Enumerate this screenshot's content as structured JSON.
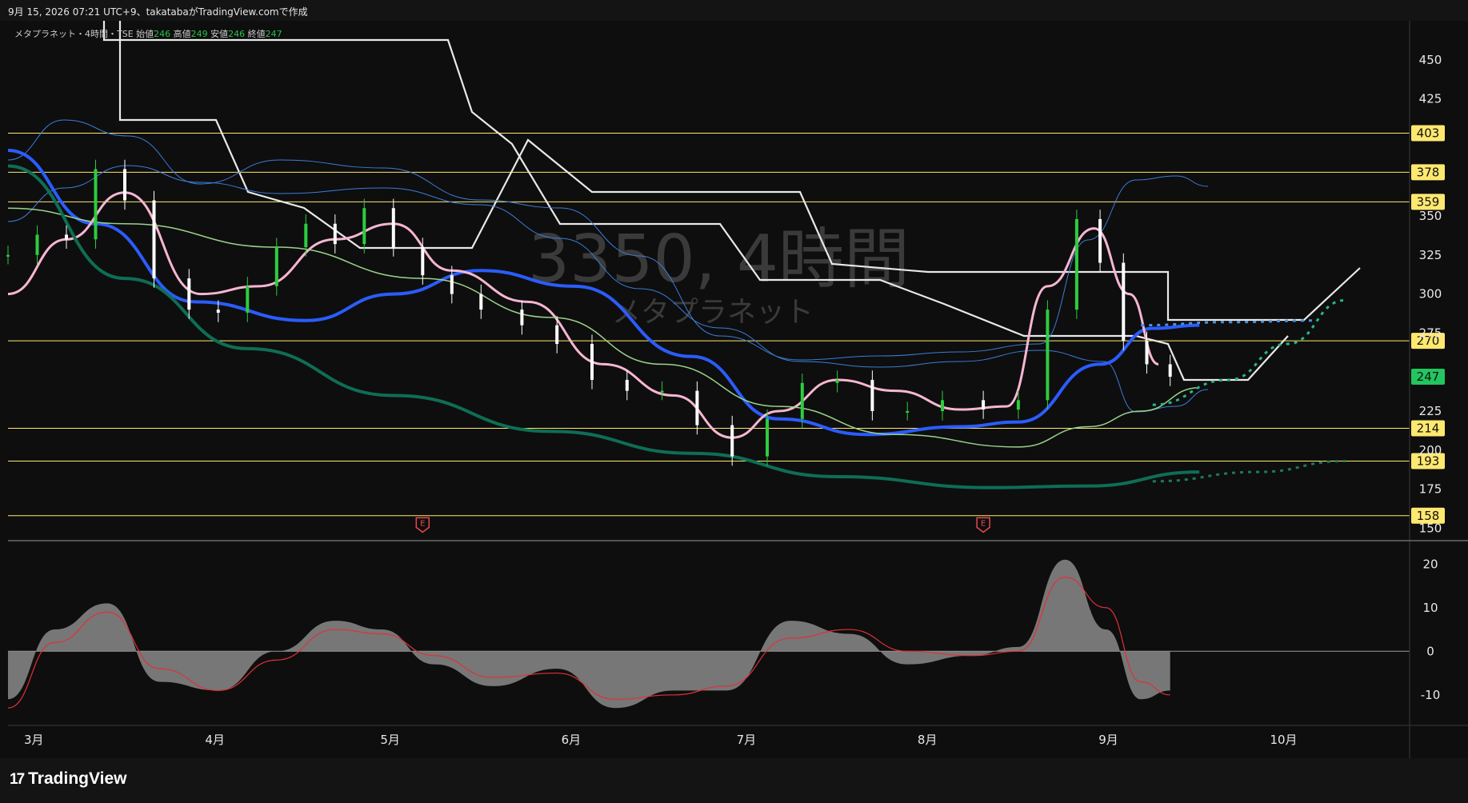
{
  "header": {
    "caption": "9月 15, 2026 07:21 UTC+9、takatabaがTradingView.comで作成"
  },
  "legend": {
    "symbol": "メタプラネット・4時間・TSE",
    "open_label": "始値",
    "open": "246",
    "high_label": "高値",
    "high": "249",
    "low_label": "安値",
    "low": "246",
    "close_label": "終値",
    "close": "247"
  },
  "watermark": {
    "ticker": "3350, 4時間",
    "name": "メタプラネット"
  },
  "brand": {
    "name": "TradingView"
  },
  "colors": {
    "bull": "#2ecc40",
    "bear": "#ffffff",
    "level_line": "#ffe870",
    "blue_ma": "#2b5cff",
    "pink_ma": "#f7b6d2",
    "green_long_ma": "#0e6e55",
    "panel_fill": "#8a8a8a"
  },
  "chart_data": {
    "type": "line",
    "price_axis": {
      "ticks": [
        450,
        425,
        350,
        325,
        300,
        275,
        225,
        200,
        175,
        150
      ],
      "range": [
        142,
        475
      ]
    },
    "horizontal_levels": [
      403,
      378,
      359,
      270,
      214,
      193,
      158
    ],
    "last_price": 247,
    "time_axis": {
      "labels": [
        "3月",
        "4月",
        "5月",
        "6月",
        "7月",
        "8月",
        "9月",
        "10月"
      ],
      "range": [
        "2026-02-28",
        "2026-10-26"
      ]
    },
    "earnings_markers": [
      "E",
      "E"
    ],
    "close_series": {
      "dates": [
        "2026-02-28",
        "2026-03-05",
        "2026-03-10",
        "2026-03-15",
        "2026-03-20",
        "2026-03-25",
        "2026-03-31",
        "2026-04-05",
        "2026-04-10",
        "2026-04-15",
        "2026-04-20",
        "2026-04-25",
        "2026-04-30",
        "2026-05-05",
        "2026-05-10",
        "2026-05-15",
        "2026-05-20",
        "2026-05-27",
        "2026-06-02",
        "2026-06-08",
        "2026-06-14",
        "2026-06-20",
        "2026-06-26",
        "2026-07-02",
        "2026-07-08",
        "2026-07-14",
        "2026-07-20",
        "2026-07-26",
        "2026-08-01",
        "2026-08-07",
        "2026-08-14",
        "2026-08-20",
        "2026-08-25",
        "2026-08-30",
        "2026-09-03",
        "2026-09-07",
        "2026-09-11",
        "2026-09-15"
      ],
      "values": [
        325,
        338,
        335,
        380,
        360,
        310,
        290,
        288,
        305,
        330,
        345,
        332,
        355,
        330,
        312,
        300,
        290,
        280,
        268,
        245,
        238,
        238,
        216,
        196,
        220,
        243,
        245,
        225,
        225,
        232,
        226,
        232,
        290,
        348,
        320,
        270,
        255,
        247
      ]
    },
    "series": [
      {
        "dates": [
          "2026-02-28",
          "2026-03-15",
          "2026-04-01",
          "2026-04-20",
          "2026-05-05",
          "2026-05-20",
          "2026-06-05",
          "2026-06-25",
          "2026-07-10",
          "2026-07-25",
          "2026-08-10",
          "2026-08-20",
          "2026-09-03",
          "2026-09-12",
          "2026-09-20"
        ],
        "values": [
          392,
          345,
          295,
          283,
          300,
          315,
          305,
          260,
          220,
          210,
          215,
          218,
          255,
          278,
          280
        ]
      },
      {
        "dates": [
          "2026-02-28",
          "2026-03-10",
          "2026-03-20",
          "2026-04-02",
          "2026-04-12",
          "2026-04-25",
          "2026-05-05",
          "2026-05-15",
          "2026-05-28",
          "2026-06-10",
          "2026-06-22",
          "2026-07-02",
          "2026-07-10",
          "2026-07-20",
          "2026-07-30",
          "2026-08-10",
          "2026-08-18",
          "2026-08-25",
          "2026-09-02",
          "2026-09-08",
          "2026-09-13"
        ],
        "values": [
          300,
          335,
          365,
          300,
          305,
          335,
          345,
          315,
          295,
          255,
          235,
          208,
          225,
          245,
          238,
          226,
          228,
          305,
          342,
          300,
          255
        ]
      },
      {
        "dates": [
          "2026-02-28",
          "2026-03-20",
          "2026-04-15",
          "2026-05-10",
          "2026-06-01",
          "2026-06-20",
          "2026-07-10",
          "2026-07-30",
          "2026-08-20",
          "2026-09-01",
          "2026-09-10",
          "2026-09-20"
        ],
        "values": [
          355,
          345,
          330,
          310,
          285,
          255,
          228,
          210,
          202,
          215,
          225,
          240
        ]
      },
      {
        "dates": [
          "2026-02-28",
          "2026-03-20",
          "2026-04-10",
          "2026-05-05",
          "2026-06-01",
          "2026-06-25",
          "2026-07-20",
          "2026-08-15",
          "2026-09-01",
          "2026-09-20"
        ],
        "values": [
          382,
          310,
          265,
          235,
          212,
          198,
          183,
          176,
          177,
          186
        ]
      },
      {
        "dates": [
          "2026-09-12",
          "2026-09-25",
          "2026-10-05",
          "2026-10-15"
        ],
        "values": [
          229,
          245,
          268,
          296
        ],
        "dashed": true
      },
      {
        "dates": [
          "2026-09-12",
          "2026-09-30",
          "2026-10-15"
        ],
        "values": [
          180,
          186,
          193
        ],
        "dashed": true
      },
      {
        "dates": [
          "2026-09-10",
          "2026-09-25",
          "2026-10-10"
        ],
        "values": [
          280,
          282,
          283
        ],
        "dashed": true
      }
    ],
    "oscillator": {
      "axis_ticks": [
        20,
        10,
        0,
        -10
      ],
      "range": [
        -17,
        25
      ],
      "dates": [
        "2026-02-28",
        "2026-03-08",
        "2026-03-17",
        "2026-03-26",
        "2026-04-05",
        "2026-04-15",
        "2026-04-25",
        "2026-05-03",
        "2026-05-12",
        "2026-05-22",
        "2026-06-02",
        "2026-06-12",
        "2026-06-22",
        "2026-07-01",
        "2026-07-12",
        "2026-07-22",
        "2026-08-01",
        "2026-08-12",
        "2026-08-20",
        "2026-08-28",
        "2026-09-04",
        "2026-09-10",
        "2026-09-15"
      ],
      "histogram": [
        -11,
        5,
        11,
        -7,
        -9,
        0,
        7,
        5,
        -3,
        -8,
        -4,
        -13,
        -9,
        -9,
        7,
        4,
        -3,
        -1,
        1,
        21,
        5,
        -11,
        -9
      ],
      "signal": [
        -13,
        2,
        9,
        -4,
        -9,
        -2,
        5,
        4,
        -1,
        -6,
        -5,
        -11,
        -10,
        -8,
        3,
        5,
        0,
        -1,
        0,
        17,
        10,
        -7,
        -10
      ]
    }
  }
}
